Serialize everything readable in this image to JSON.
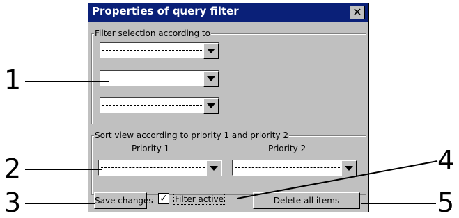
{
  "dialog": {
    "title": "Properties of query filter",
    "close_glyph": "✕"
  },
  "filter_group": {
    "legend": "Filter selection according to"
  },
  "sort_group": {
    "legend": "Sort view according to priority 1 and priority 2",
    "priority1_label": "Priority 1",
    "priority2_label": "Priority 2"
  },
  "buttons": {
    "save": "Save changes",
    "delete_all": "Delete all items"
  },
  "filter_active": {
    "label": "Filter active",
    "checked": true,
    "check_glyph": "✓"
  },
  "callouts": [
    "1",
    "2",
    "3",
    "4",
    "5"
  ]
}
